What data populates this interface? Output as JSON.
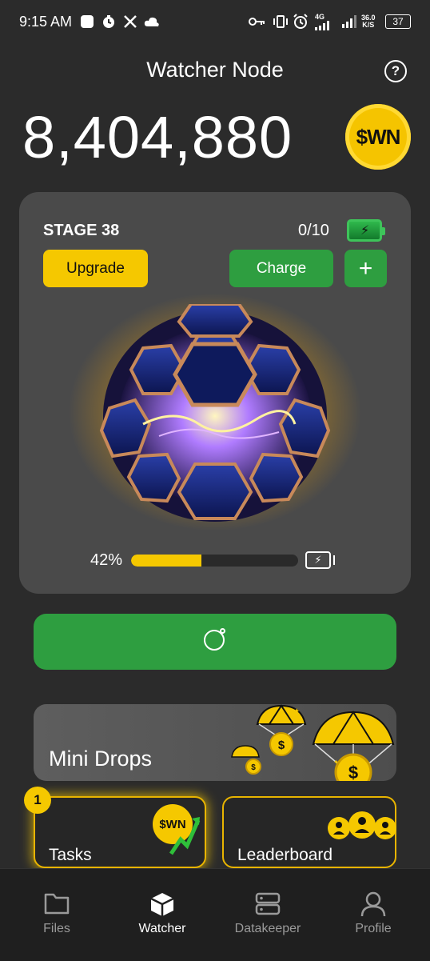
{
  "status_bar": {
    "time": "9:15 AM",
    "network_speed": "36.0",
    "network_unit": "K/S",
    "battery": "37",
    "signal_label": "4G"
  },
  "header": {
    "title": "Watcher Node"
  },
  "balance": {
    "amount": "8,404,880",
    "coin_label": "$WN"
  },
  "node_card": {
    "stage": "STAGE 38",
    "charges": "0/10",
    "upgrade_label": "Upgrade",
    "charge_label": "Charge",
    "plus_label": "+",
    "progress_text": "42%",
    "progress_value": 0.42
  },
  "mini_drops": {
    "label": "Mini Drops"
  },
  "tiles": {
    "tasks_label": "Tasks",
    "tasks_badge": "1",
    "tasks_coin_label": "$WN",
    "leaderboard_label": "Leaderboard"
  },
  "tabs": [
    {
      "label": "Files",
      "icon": "folder-icon",
      "active": false
    },
    {
      "label": "Watcher",
      "icon": "cube-icon",
      "active": true
    },
    {
      "label": "Datakeeper",
      "icon": "server-icon",
      "active": false
    },
    {
      "label": "Profile",
      "icon": "person-icon",
      "active": false
    }
  ],
  "colors": {
    "accent_yellow": "#f5c800",
    "accent_green": "#2e9e40",
    "background": "#2b2b2b",
    "card": "#4a4a4a"
  }
}
